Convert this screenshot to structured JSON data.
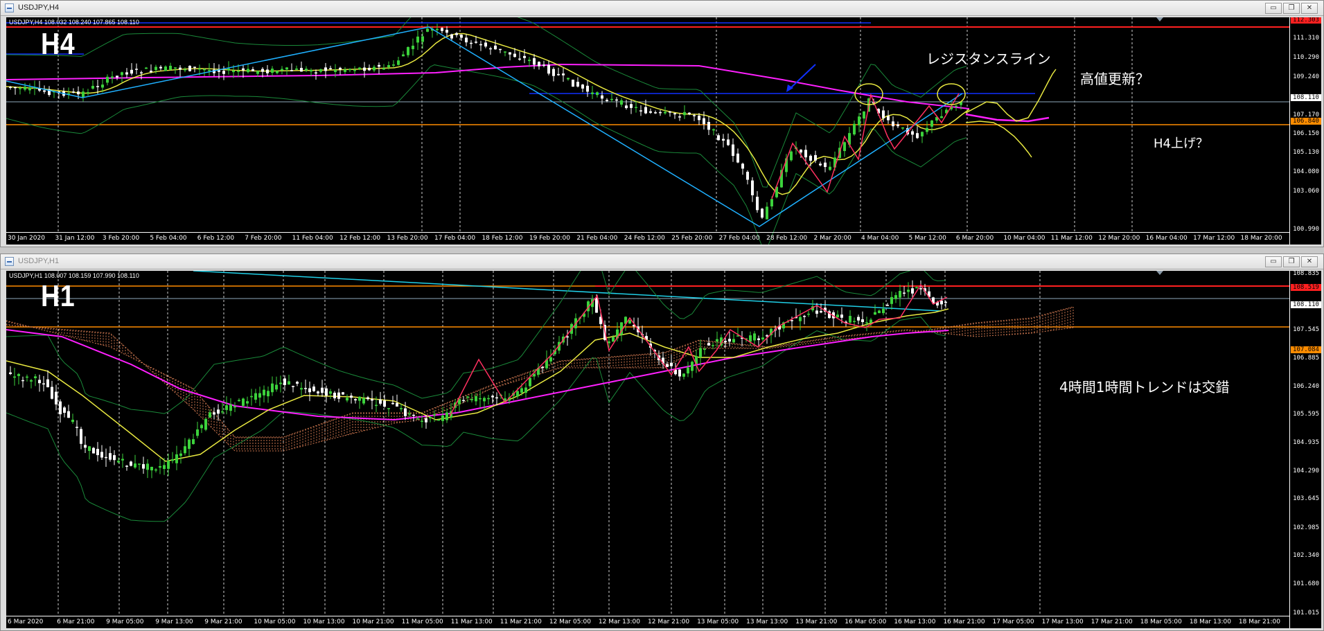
{
  "windows": [
    {
      "id": "h4",
      "title": "USDJPY,H4",
      "info": "USDJPY,H4  108.032 108.240 107.865 108.110",
      "big_label": "H4",
      "price_range": [
        100.99,
        112.3
      ],
      "y_ticks": [
        "111.310",
        "110.290",
        "109.240",
        "107.170",
        "106.150",
        "105.130",
        "104.080",
        "103.060",
        "100.990"
      ],
      "price_tags": [
        {
          "value": "112.303",
          "color": "#ff2020"
        },
        {
          "value": "108.110",
          "color": "#ffffff"
        },
        {
          "value": "106.840",
          "color": "#ff8c00"
        }
      ],
      "x_ticks": [
        "30 Jan 2020",
        "31 Jan 12:00",
        "3 Feb 20:00",
        "5 Feb 04:00",
        "6 Feb 12:00",
        "7 Feb 20:00",
        "11 Feb 04:00",
        "12 Feb 12:00",
        "13 Feb 20:00",
        "17 Feb 04:00",
        "18 Feb 12:00",
        "19 Feb 20:00",
        "21 Feb 04:00",
        "24 Feb 12:00",
        "25 Feb 20:00",
        "27 Feb 04:00",
        "28 Feb 12:00",
        "2 Mar 20:00",
        "4 Mar 04:00",
        "5 Mar 12:00",
        "6 Mar 20:00",
        "10 Mar 04:00",
        "11 Mar 12:00",
        "12 Mar 20:00",
        "16 Mar 04:00",
        "17 Mar 12:00",
        "18 Mar 20:00"
      ],
      "annotations": [
        {
          "text": "レジスタンスライン",
          "kind": "resistance-line-annotation"
        },
        {
          "text": "高値更新？",
          "kind": "new-high-annotation"
        },
        {
          "text": "H4上げ？",
          "kind": "h4-rise-annotation"
        }
      ],
      "colors": {
        "horizontal_red": "#ff2020",
        "horizontal_orange": "#ff8c00",
        "horizontal_blue": "#1030ff",
        "trendline": "#1fb0ff",
        "ma_long": "#ff20ff",
        "ma_short": "#e8e840",
        "zigzag": "#ff3060",
        "bollinger": "#1a8a3a",
        "bull_candle": "#3cd23c",
        "bear_candle": "#ffffff"
      }
    },
    {
      "id": "h1",
      "title": "USDJPY,H1",
      "info": "USDJPY,H1  108.007 108.159 107.990 108.110",
      "big_label": "H1",
      "price_range": [
        101.015,
        108.835
      ],
      "y_ticks": [
        "108.835",
        "107.545",
        "106.885",
        "106.240",
        "105.595",
        "104.935",
        "104.290",
        "103.645",
        "102.985",
        "102.340",
        "101.680",
        "101.015"
      ],
      "price_tags": [
        {
          "value": "108.519",
          "color": "#ff2020"
        },
        {
          "value": "108.110",
          "color": "#ffffff"
        },
        {
          "value": "107.084",
          "color": "#ff8c00"
        }
      ],
      "x_ticks": [
        "6 Mar 2020",
        "6 Mar 21:00",
        "9 Mar 05:00",
        "9 Mar 13:00",
        "9 Mar 21:00",
        "10 Mar 05:00",
        "10 Mar 13:00",
        "10 Mar 21:00",
        "11 Mar 05:00",
        "11 Mar 13:00",
        "11 Mar 21:00",
        "12 Mar 05:00",
        "12 Mar 13:00",
        "12 Mar 21:00",
        "13 Mar 05:00",
        "13 Mar 13:00",
        "13 Mar 21:00",
        "16 Mar 05:00",
        "16 Mar 13:00",
        "16 Mar 21:00",
        "17 Mar 05:00",
        "17 Mar 13:00",
        "17 Mar 21:00",
        "18 Mar 05:00",
        "18 Mar 13:00",
        "18 Mar 21:00"
      ],
      "annotations": [
        {
          "text": "4時間1時間トレンドは交錯",
          "kind": "trend-annotation"
        }
      ],
      "colors": {
        "horizontal_red": "#ff2020",
        "horizontal_orange": "#ff8c00",
        "trendline": "#20d0e8",
        "ma_long": "#ff20ff",
        "ma_short": "#e8e840",
        "zigzag": "#ff3060",
        "bollinger": "#1a8a3a",
        "ichimoku_cloud": "#d07850",
        "bull_candle": "#3cd23c",
        "bear_candle": "#ffffff"
      }
    }
  ],
  "window_buttons": {
    "minimize": "▭",
    "restore": "❐",
    "close": "✕"
  }
}
